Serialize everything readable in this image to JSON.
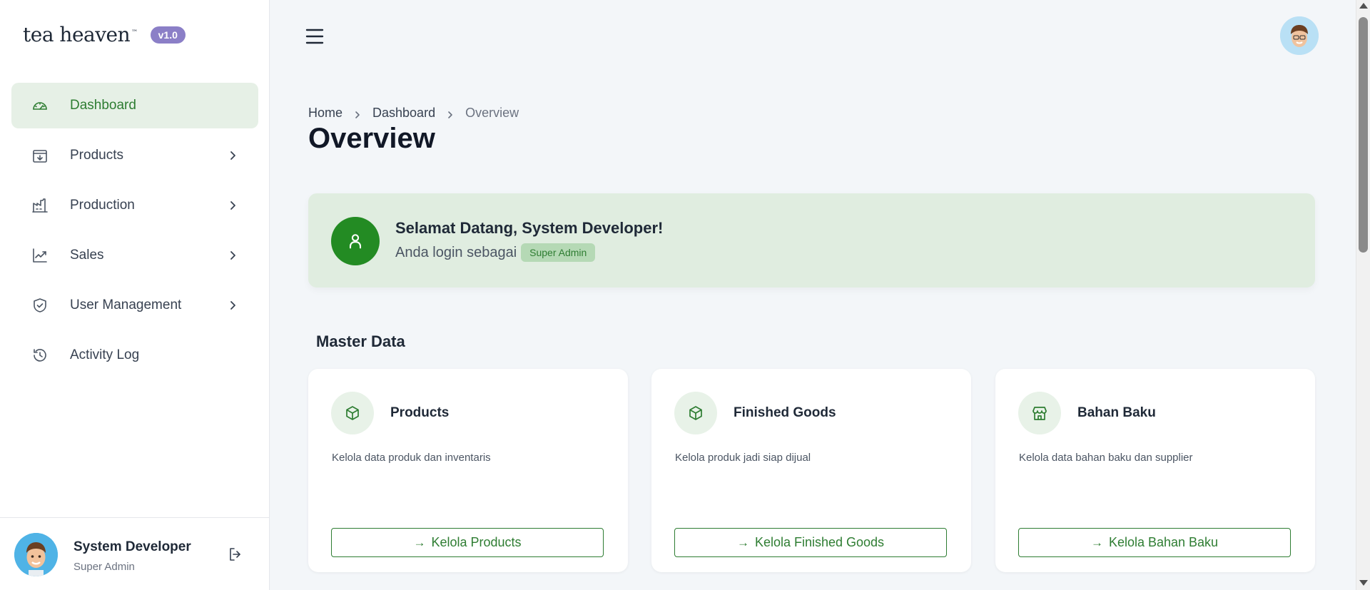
{
  "brand": {
    "name": "tea heaven",
    "tm": "™",
    "version": "v1.0"
  },
  "sidebar": {
    "items": [
      {
        "label": "Dashboard",
        "icon": "gauge-icon",
        "active": true,
        "has_submenu": false
      },
      {
        "label": "Products",
        "icon": "archive-box-icon",
        "active": false,
        "has_submenu": true
      },
      {
        "label": "Production",
        "icon": "factory-icon",
        "active": false,
        "has_submenu": true
      },
      {
        "label": "Sales",
        "icon": "trend-chart-icon",
        "active": false,
        "has_submenu": true
      },
      {
        "label": "User Management",
        "icon": "shield-check-icon",
        "active": false,
        "has_submenu": true
      },
      {
        "label": "Activity Log",
        "icon": "history-icon",
        "active": false,
        "has_submenu": false
      }
    ]
  },
  "user": {
    "name": "System Developer",
    "role": "Super Admin"
  },
  "breadcrumb": {
    "home": "Home",
    "dashboard": "Dashboard",
    "current": "Overview"
  },
  "page": {
    "title": "Overview"
  },
  "welcome": {
    "title": "Selamat Datang, System Developer!",
    "subtitle": "Anda login sebagai",
    "role": "Super Admin"
  },
  "master_data": {
    "title": "Master Data",
    "cards": [
      {
        "title": "Products",
        "description": "Kelola data produk dan inventaris",
        "button": "Kelola Products",
        "icon": "cube-icon"
      },
      {
        "title": "Finished Goods",
        "description": "Kelola produk jadi siap dijual",
        "button": "Kelola Finished Goods",
        "icon": "cube-icon"
      },
      {
        "title": "Bahan Baku",
        "description": "Kelola data bahan baku dan supplier",
        "button": "Kelola Bahan Baku",
        "icon": "store-icon"
      }
    ]
  },
  "colors": {
    "accent": "#2e7d32",
    "accent_dark": "#238b23",
    "welcome_bg": "#e0ede0",
    "version_badge": "#8b7fc7"
  }
}
